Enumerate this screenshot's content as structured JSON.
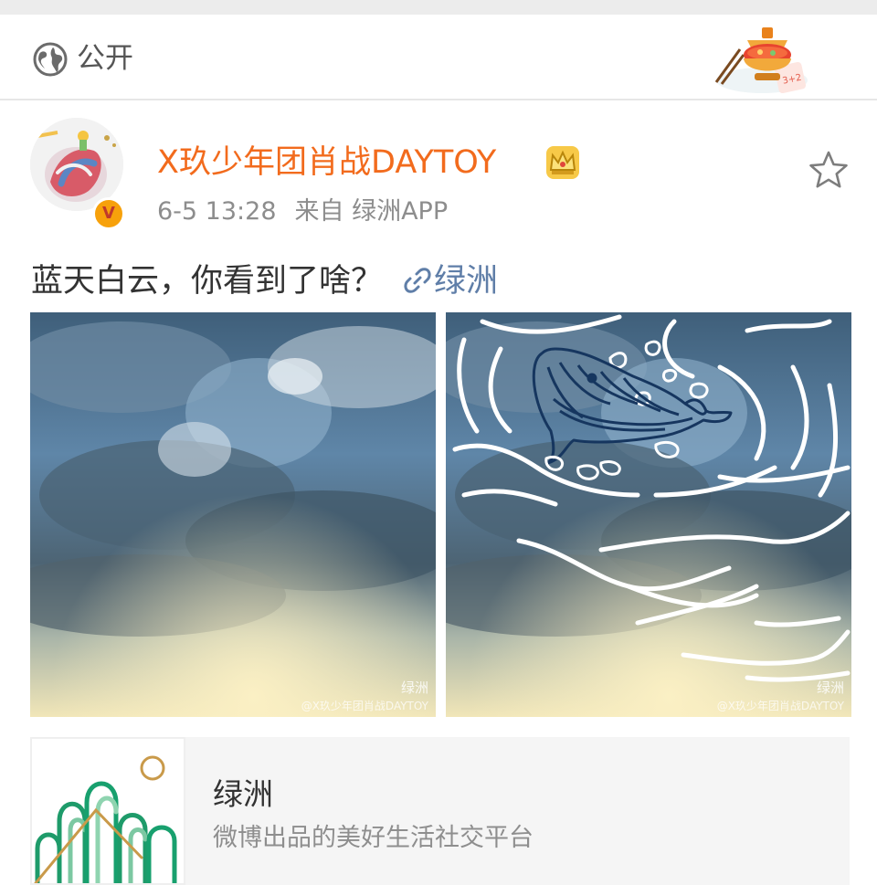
{
  "visibility": {
    "icon": "globe-icon",
    "label": "公开"
  },
  "header_sticker": {
    "icon": "hotpot-sticker"
  },
  "post": {
    "author": {
      "name": "X玖少年团肖战DAYTOY",
      "verified_badge": "V",
      "crown_icon": "crown-icon",
      "name_color": "#f26b1d"
    },
    "time": "6-5 13:28",
    "source": "来自 绿洲APP",
    "text": "蓝天白云，你看到了啥？",
    "link_label": "绿洲",
    "link_color": "#5f7ea8",
    "images": [
      {
        "watermark_app": "绿洲",
        "watermark_user": "@X玖少年团肖战DAYTOY",
        "content": "sky-clouds"
      },
      {
        "watermark_app": "绿洲",
        "watermark_user": "@X玖少年团肖战DAYTOY",
        "content": "sky-clouds-whale-drawing"
      }
    ]
  },
  "card": {
    "title": "绿洲",
    "description": "微博出品的美好生活社交平台"
  }
}
